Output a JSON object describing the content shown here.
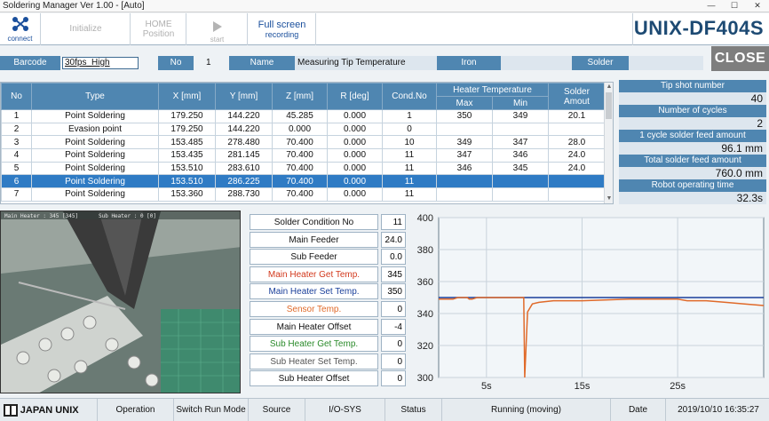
{
  "window": {
    "title": "Soldering Manager Ver 1.00 - [Auto]",
    "minimize": "—",
    "maximize": "☐",
    "close": "✕"
  },
  "toolbar": {
    "connect": "connect",
    "initialize": "Initialize",
    "home_line1": "HOME",
    "home_line2": "Position",
    "start": "start",
    "record_line1": "Full screen",
    "record_line2": "recording",
    "brand": "UNIX-DF404S"
  },
  "info": {
    "barcode_label": "Barcode",
    "barcode_value": "30fps_High",
    "no_label": "No",
    "no_value": "1",
    "name_label": "Name",
    "name_value": "Measuring Tip Temperature",
    "iron_label": "Iron",
    "iron_value": "",
    "solder_label": "Solder",
    "solder_value": "",
    "close": "CLOSE"
  },
  "table": {
    "headers": {
      "no": "No",
      "type": "Type",
      "x": "X [mm]",
      "y": "Y [mm]",
      "z": "Z [mm]",
      "r": "R [deg]",
      "cond": "Cond.No",
      "heater": "Heater Temperature",
      "max": "Max",
      "min": "Min",
      "solder1": "Solder",
      "solder2": "Amout"
    },
    "rows": [
      [
        "1",
        "Point Soldering",
        "179.250",
        "144.220",
        "45.285",
        "0.000",
        "1",
        "350",
        "349",
        "20.1"
      ],
      [
        "2",
        "Evasion point",
        "179.250",
        "144.220",
        "0.000",
        "0.000",
        "0",
        "",
        "",
        ""
      ],
      [
        "3",
        "Point Soldering",
        "153.485",
        "278.480",
        "70.400",
        "0.000",
        "10",
        "349",
        "347",
        "28.0"
      ],
      [
        "4",
        "Point Soldering",
        "153.435",
        "281.145",
        "70.400",
        "0.000",
        "11",
        "347",
        "346",
        "24.0"
      ],
      [
        "5",
        "Point Soldering",
        "153.510",
        "283.610",
        "70.400",
        "0.000",
        "11",
        "346",
        "345",
        "24.0"
      ],
      [
        "6",
        "Point Soldering",
        "153.510",
        "286.225",
        "70.400",
        "0.000",
        "11",
        "",
        "",
        ""
      ],
      [
        "7",
        "Point Soldering",
        "153.360",
        "288.730",
        "70.400",
        "0.000",
        "11",
        "",
        "",
        ""
      ]
    ],
    "selected_row": 5,
    "scroll_up": "▲",
    "scroll_down": "▼"
  },
  "stats": [
    {
      "label": "Tip shot number",
      "value": "40"
    },
    {
      "label": "Number of cycles",
      "value": "2"
    },
    {
      "label": "1 cycle solder feed amount",
      "value": "96.1  mm"
    },
    {
      "label": "Total solder feed amount",
      "value": "760.0  mm"
    },
    {
      "label": "Robot operating time",
      "value": "32.3s"
    }
  ],
  "camera": {
    "overlay_left": "Main Heater : 345 [345]",
    "overlay_right": "Sub Heater : 0 [0]"
  },
  "conditions": [
    {
      "label": "Solder Condition No",
      "value": "11",
      "color": "#111111"
    },
    {
      "label": "Main Feeder",
      "value": "24.0",
      "color": "#111111"
    },
    {
      "label": "Sub Feeder",
      "value": "0.0",
      "color": "#111111"
    },
    {
      "label": "Main Heater Get Temp.",
      "value": "345",
      "color": "#d2381c"
    },
    {
      "label": "Main Heater Set Temp.",
      "value": "350",
      "color": "#1a3f9a"
    },
    {
      "label": "Sensor Temp.",
      "value": "0",
      "color": "#e06a2a"
    },
    {
      "label": "Main Heater Offset",
      "value": "-4",
      "color": "#111111"
    },
    {
      "label": "Sub Heater Get Temp.",
      "value": "0",
      "color": "#2a8a2a"
    },
    {
      "label": "Sub Heater Set Temp.",
      "value": "0",
      "color": "#555555"
    },
    {
      "label": "Sub Heater Offset",
      "value": "0",
      "color": "#111111"
    }
  ],
  "chart_data": {
    "type": "line",
    "title": "",
    "xlabel": "",
    "ylabel": "",
    "xlim": [
      0,
      34
    ],
    "ylim": [
      300,
      400
    ],
    "xticks": [
      5,
      15,
      25
    ],
    "xtick_labels": [
      "5s",
      "15s",
      "25s"
    ],
    "yticks": [
      300,
      320,
      340,
      360,
      380,
      400
    ],
    "grid": true,
    "series": [
      {
        "color": "#1a3f9a",
        "x": [
          0,
          34
        ],
        "y": [
          350,
          350
        ]
      },
      {
        "color": "#e06a2a",
        "x": [
          0,
          1.5,
          2,
          3,
          3.2,
          3.5,
          4,
          5,
          6,
          7,
          8,
          8.9,
          9.0,
          9.3,
          9.8,
          10.5,
          12,
          15,
          20,
          25,
          26,
          28,
          30,
          32,
          34
        ],
        "y": [
          349,
          349,
          350,
          350,
          349,
          349,
          350,
          350,
          350,
          350,
          350,
          350,
          300,
          341,
          346,
          347,
          348,
          348,
          349,
          349,
          348,
          348,
          347,
          346,
          345
        ]
      }
    ]
  },
  "status": {
    "company": "JAPAN UNIX",
    "operation_label": "Operation",
    "operation_value": "Switch Run Mode",
    "source_label": "Source",
    "source_value": "I/O-SYS",
    "status_label": "Status",
    "status_value": "Running (moving)",
    "date_label": "Date",
    "date_value": "2019/10/10 16:35:27"
  }
}
